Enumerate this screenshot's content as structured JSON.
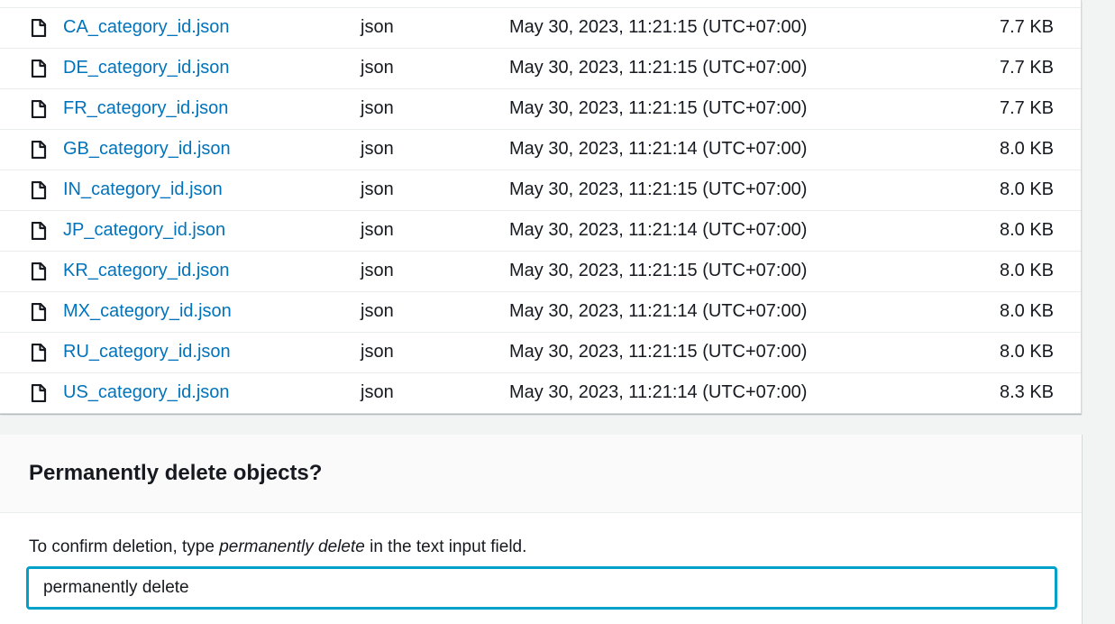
{
  "files": [
    {
      "name": "CA_category_id.json",
      "type": "json",
      "last_modified": "May 30, 2023, 11:21:15 (UTC+07:00)",
      "size": "7.7 KB"
    },
    {
      "name": "DE_category_id.json",
      "type": "json",
      "last_modified": "May 30, 2023, 11:21:15 (UTC+07:00)",
      "size": "7.7 KB"
    },
    {
      "name": "FR_category_id.json",
      "type": "json",
      "last_modified": "May 30, 2023, 11:21:15 (UTC+07:00)",
      "size": "7.7 KB"
    },
    {
      "name": "GB_category_id.json",
      "type": "json",
      "last_modified": "May 30, 2023, 11:21:14 (UTC+07:00)",
      "size": "8.0 KB"
    },
    {
      "name": "IN_category_id.json",
      "type": "json",
      "last_modified": "May 30, 2023, 11:21:15 (UTC+07:00)",
      "size": "8.0 KB"
    },
    {
      "name": "JP_category_id.json",
      "type": "json",
      "last_modified": "May 30, 2023, 11:21:14 (UTC+07:00)",
      "size": "8.0 KB"
    },
    {
      "name": "KR_category_id.json",
      "type": "json",
      "last_modified": "May 30, 2023, 11:21:15 (UTC+07:00)",
      "size": "8.0 KB"
    },
    {
      "name": "MX_category_id.json",
      "type": "json",
      "last_modified": "May 30, 2023, 11:21:14 (UTC+07:00)",
      "size": "8.0 KB"
    },
    {
      "name": "RU_category_id.json",
      "type": "json",
      "last_modified": "May 30, 2023, 11:21:15 (UTC+07:00)",
      "size": "8.0 KB"
    },
    {
      "name": "US_category_id.json",
      "type": "json",
      "last_modified": "May 30, 2023, 11:21:14 (UTC+07:00)",
      "size": "8.3 KB"
    }
  ],
  "file_icon": "file-icon",
  "confirm": {
    "title": "Permanently delete objects?",
    "instruction_prefix": "To confirm deletion, type ",
    "instruction_keyword": "permanently delete",
    "instruction_suffix": " in the text input field.",
    "input_value": "permanently delete"
  },
  "colors": {
    "link": "#0073bb",
    "text": "#16191f",
    "input_focus": "#00a1c9"
  }
}
